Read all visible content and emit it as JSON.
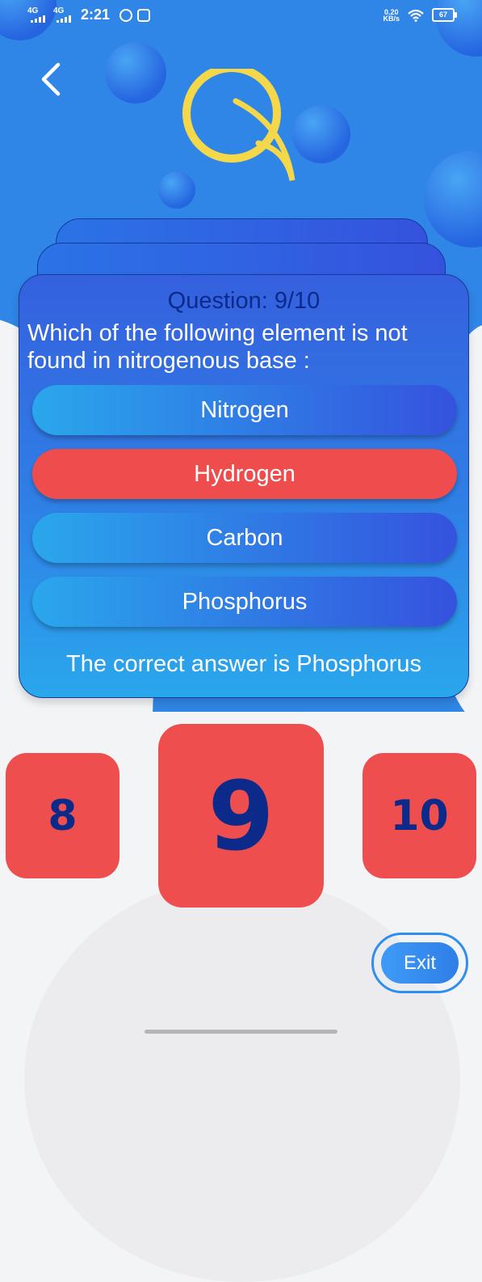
{
  "status_bar": {
    "signal1_label": "4G",
    "signal2_label": "4G",
    "time": "2:21",
    "net_speed_value": "0.20",
    "net_speed_unit": "KB/s",
    "battery": "67"
  },
  "quiz": {
    "question_counter": "Question: 9/10",
    "question_text": "Which of the following element is not found in nitrogenous base :",
    "options": [
      {
        "label": "Nitrogen",
        "state": "normal"
      },
      {
        "label": "Hydrogen",
        "state": "wrong"
      },
      {
        "label": "Carbon",
        "state": "normal"
      },
      {
        "label": "Phosphorus",
        "state": "normal"
      }
    ],
    "answer_text": "The correct answer is Phosphorus"
  },
  "pager": {
    "prev": "8",
    "current": "9",
    "next": "10"
  },
  "exit_label": "Exit",
  "colors": {
    "background_blue": "#2f86e6",
    "wrong_red": "#ef4d4d",
    "dark_navy": "#0b2a8a",
    "logo_yellow": "#f5d84a"
  },
  "icons": {
    "back": "chevron-left-icon",
    "logo": "q-logo-icon"
  }
}
